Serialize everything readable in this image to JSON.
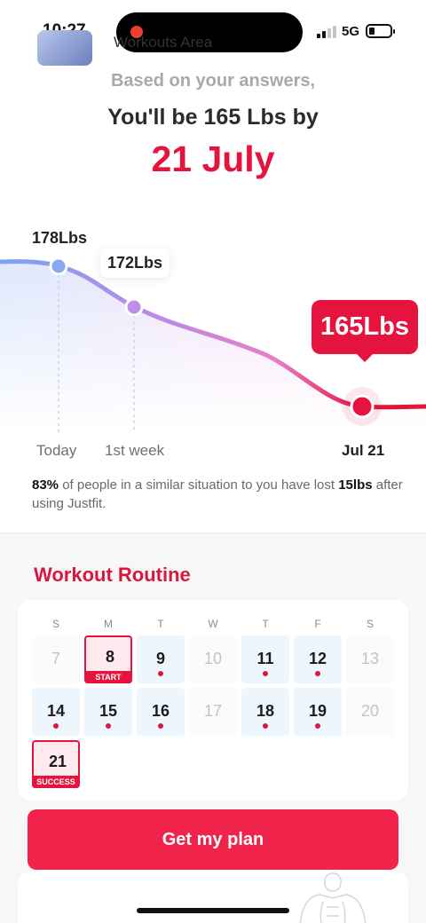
{
  "status_bar": {
    "time": "10:27",
    "network": "5G"
  },
  "header": {
    "subtitle": "Based on your answers,",
    "headline": "You'll be 165 Lbs by",
    "target_date": "21 July"
  },
  "chart_data": {
    "type": "line",
    "x": [
      "Today",
      "1st week",
      "Jul 21"
    ],
    "values": [
      178,
      172,
      165
    ],
    "point_labels": [
      "178Lbs",
      "172Lbs",
      "165Lbs"
    ],
    "colors": {
      "start": "#7aa3f0",
      "mid": "#b98be8",
      "end": "#e5133d"
    }
  },
  "stat": {
    "percent": "83%",
    "text1": " of people in a similar situation to you have lost ",
    "amount": "15lbs",
    "text2": " after using Justfit."
  },
  "workout": {
    "title": "Workout Routine",
    "weekdays": [
      "S",
      "M",
      "T",
      "W",
      "T",
      "F",
      "S"
    ],
    "days": [
      {
        "num": "7",
        "muted": true
      },
      {
        "num": "8",
        "tag": "START"
      },
      {
        "num": "9",
        "dot": true
      },
      {
        "num": "10",
        "muted": true
      },
      {
        "num": "11",
        "dot": true
      },
      {
        "num": "12",
        "dot": true
      },
      {
        "num": "13",
        "muted": true
      },
      {
        "num": "14",
        "dot": true
      },
      {
        "num": "15",
        "dot": true
      },
      {
        "num": "16",
        "dot": true
      },
      {
        "num": "17",
        "muted": true
      },
      {
        "num": "18",
        "dot": true
      },
      {
        "num": "19",
        "dot": true
      },
      {
        "num": "20",
        "muted": true
      },
      {
        "num": "21",
        "tag": "SUCCESS"
      }
    ]
  },
  "cta_label": "Get my plan",
  "areas_card": {
    "title": "Workouts Area"
  },
  "accent_color": "#e5133d"
}
